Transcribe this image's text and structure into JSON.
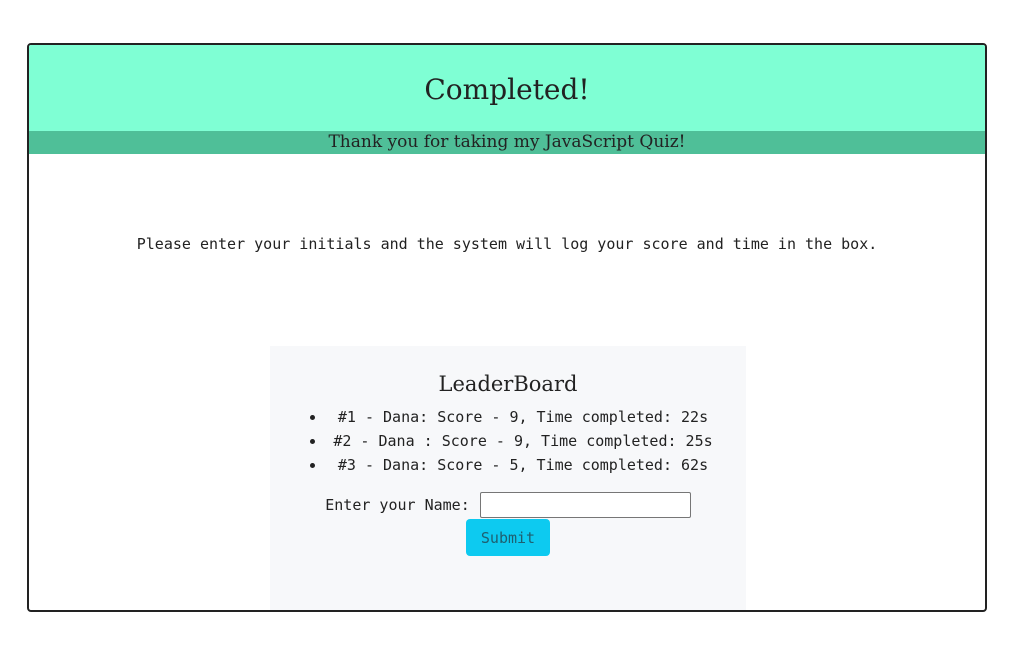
{
  "header": {
    "title": "Completed!",
    "subtitle": "Thank you for taking my JavaScript Quiz!"
  },
  "instructions": "Please enter your initials and the system will log your score and time in the box.",
  "leaderboard": {
    "title": "LeaderBoard",
    "entries": [
      "#1 - Dana: Score - 9, Time completed: 22s",
      "#2 - Dana : Score - 9, Time completed: 25s",
      "#3 - Dana: Score - 5, Time completed: 62s"
    ]
  },
  "form": {
    "name_label": "Enter your Name:",
    "name_value": "",
    "submit_label": "Submit"
  },
  "colors": {
    "header_bg": "#7fffd4",
    "subheader_bg": "#4fbf98",
    "button_bg": "#0dcaf0",
    "panel_bg": "#f7f8fa"
  }
}
